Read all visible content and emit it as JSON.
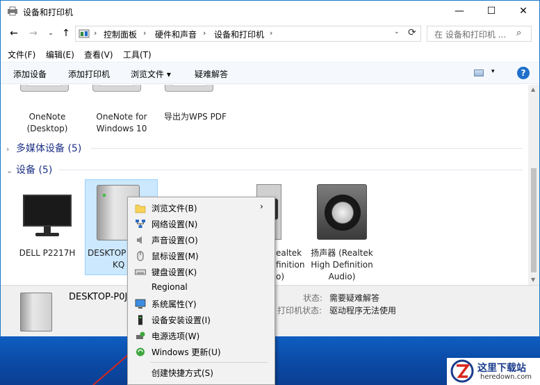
{
  "window": {
    "title": "设备和打印机",
    "minimize": "—",
    "maximize": "☐",
    "close": "✕"
  },
  "nav": {
    "back": "←",
    "forward": "→",
    "history": "⌄",
    "up": "↑"
  },
  "address": {
    "crumbs": [
      "控制面板",
      "硬件和声音",
      "设备和打印机"
    ],
    "separator": "›",
    "search_placeholder": "在 设备和打印机 ...",
    "search_glyph": "⌕",
    "refresh_glyph": "⟳",
    "dropdown_glyph": "⌄"
  },
  "menubar": [
    "文件(F)",
    "编辑(E)",
    "查看(V)",
    "工具(T)"
  ],
  "commands": [
    "添加设备",
    "添加打印机",
    "浏览文件 ▾",
    "疑难解答"
  ],
  "help_label": "?",
  "view_dropdown": "▾",
  "printers": [
    {
      "label_1": "OneNote",
      "label_2": "(Desktop)"
    },
    {
      "label_1": "OneNote for",
      "label_2": "Windows 10"
    },
    {
      "label_1": "导出为WPS PDF",
      "label_2": ""
    }
  ],
  "groups": {
    "multimedia": {
      "chev": "›",
      "label": "多媒体设备 (5)"
    },
    "devices": {
      "chev": "⌄",
      "label": "设备 (5)"
    }
  },
  "devices": [
    {
      "label_1": "DELL P2217H",
      "label_2": "",
      "label_3": ""
    },
    {
      "label_1": "DESKTOP",
      "label_2": "KQ",
      "label_3": ""
    },
    {
      "label_1": "ealtek",
      "label_2": "finition",
      "label_3": "o)"
    },
    {
      "label_1": "扬声器 (Realtek",
      "label_2": "High Definition",
      "label_3": "Audio)"
    }
  ],
  "details": {
    "name": "DESKTOP-P0J",
    "status_key": "状态:",
    "status_value": "需要疑难解答",
    "printer_key": "打印机状态:",
    "printer_value": "驱动程序无法使用"
  },
  "context_menu": {
    "items": [
      {
        "label": "浏览文件(B)",
        "icon": "folder-icon",
        "submenu": "›"
      },
      {
        "label": "网络设置(N)",
        "icon": "network-icon"
      },
      {
        "label": "声音设置(O)",
        "icon": "sound-icon"
      },
      {
        "label": "鼠标设置(M)",
        "icon": "mouse-icon"
      },
      {
        "label": "键盘设置(K)",
        "icon": "keyboard-icon"
      },
      {
        "label": "Regional",
        "icon": ""
      },
      {
        "label": "系统属性(Y)",
        "icon": "system-icon"
      },
      {
        "label": "设备安装设置(I)",
        "icon": "device-install-icon"
      },
      {
        "label": "电源选项(W)",
        "icon": "power-icon"
      },
      {
        "label": "Windows 更新(U)",
        "icon": "update-icon"
      },
      {
        "label": "创建快捷方式(S)",
        "icon": ""
      }
    ]
  },
  "watermark": {
    "title": "这里下载站",
    "url": "heredown.com"
  },
  "colors": {
    "accent": "#1f6fcb",
    "selection": "#cce8ff",
    "group_header": "#1e3287"
  }
}
